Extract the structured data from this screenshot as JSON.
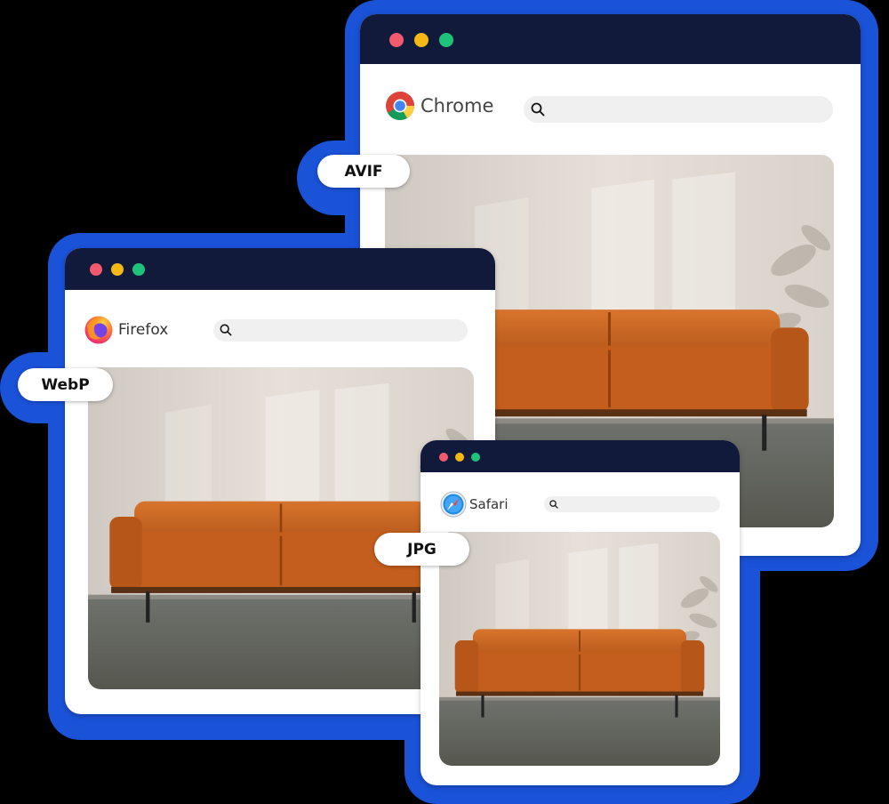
{
  "colors": {
    "background": "#000000",
    "halo": "#1a52d8",
    "titlebar": "#111a3a",
    "dot_red": "#f25a6e",
    "dot_yellow": "#f5b915",
    "dot_green": "#1fc27a",
    "sofa": "#c9621f"
  },
  "windows": {
    "chrome": {
      "brand": "Chrome",
      "format_label": "AVIF"
    },
    "firefox": {
      "brand": "Firefox",
      "format_label": "WebP"
    },
    "safari": {
      "brand": "Safari",
      "format_label": "JPG"
    }
  }
}
